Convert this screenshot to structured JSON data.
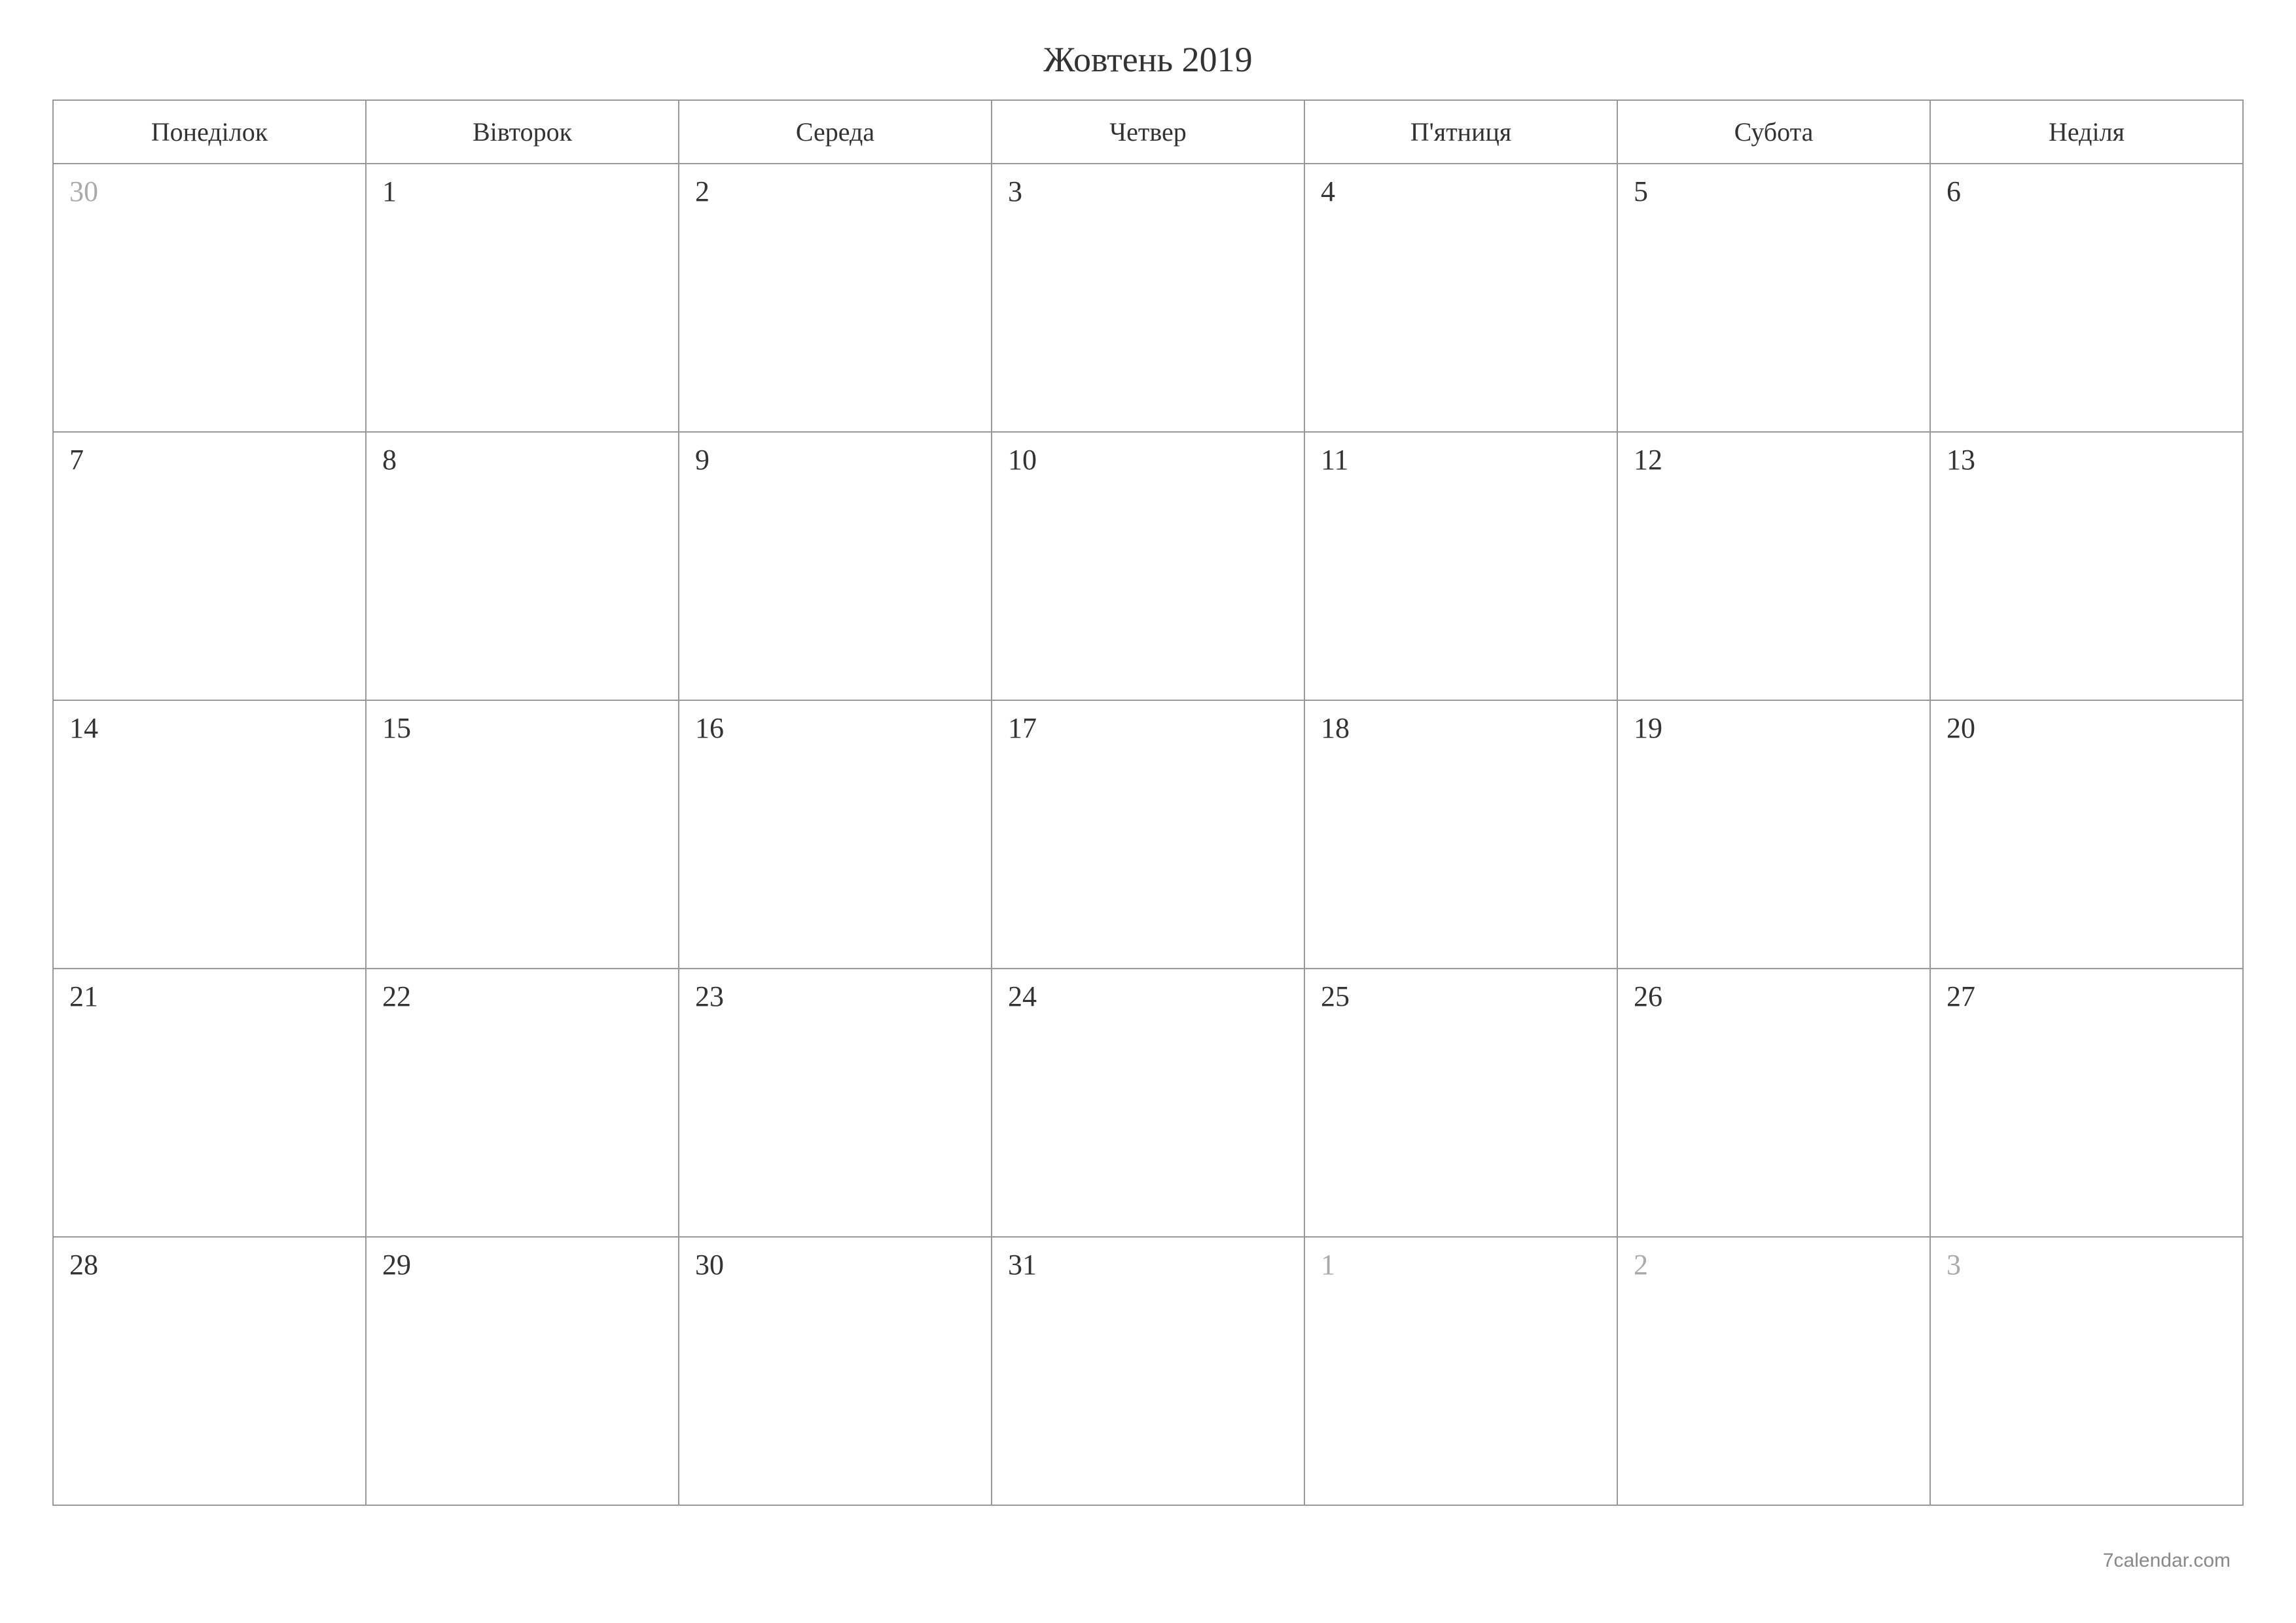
{
  "title": "Жовтень 2019",
  "weekdays": [
    "Понеділок",
    "Вівторок",
    "Середа",
    "Четвер",
    "П'ятниця",
    "Субота",
    "Неділя"
  ],
  "weeks": [
    [
      {
        "day": "30",
        "other": true
      },
      {
        "day": "1",
        "other": false
      },
      {
        "day": "2",
        "other": false
      },
      {
        "day": "3",
        "other": false
      },
      {
        "day": "4",
        "other": false
      },
      {
        "day": "5",
        "other": false
      },
      {
        "day": "6",
        "other": false
      }
    ],
    [
      {
        "day": "7",
        "other": false
      },
      {
        "day": "8",
        "other": false
      },
      {
        "day": "9",
        "other": false
      },
      {
        "day": "10",
        "other": false
      },
      {
        "day": "11",
        "other": false
      },
      {
        "day": "12",
        "other": false
      },
      {
        "day": "13",
        "other": false
      }
    ],
    [
      {
        "day": "14",
        "other": false
      },
      {
        "day": "15",
        "other": false
      },
      {
        "day": "16",
        "other": false
      },
      {
        "day": "17",
        "other": false
      },
      {
        "day": "18",
        "other": false
      },
      {
        "day": "19",
        "other": false
      },
      {
        "day": "20",
        "other": false
      }
    ],
    [
      {
        "day": "21",
        "other": false
      },
      {
        "day": "22",
        "other": false
      },
      {
        "day": "23",
        "other": false
      },
      {
        "day": "24",
        "other": false
      },
      {
        "day": "25",
        "other": false
      },
      {
        "day": "26",
        "other": false
      },
      {
        "day": "27",
        "other": false
      }
    ],
    [
      {
        "day": "28",
        "other": false
      },
      {
        "day": "29",
        "other": false
      },
      {
        "day": "30",
        "other": false
      },
      {
        "day": "31",
        "other": false
      },
      {
        "day": "1",
        "other": true
      },
      {
        "day": "2",
        "other": true
      },
      {
        "day": "3",
        "other": true
      }
    ]
  ],
  "footer": "7calendar.com"
}
